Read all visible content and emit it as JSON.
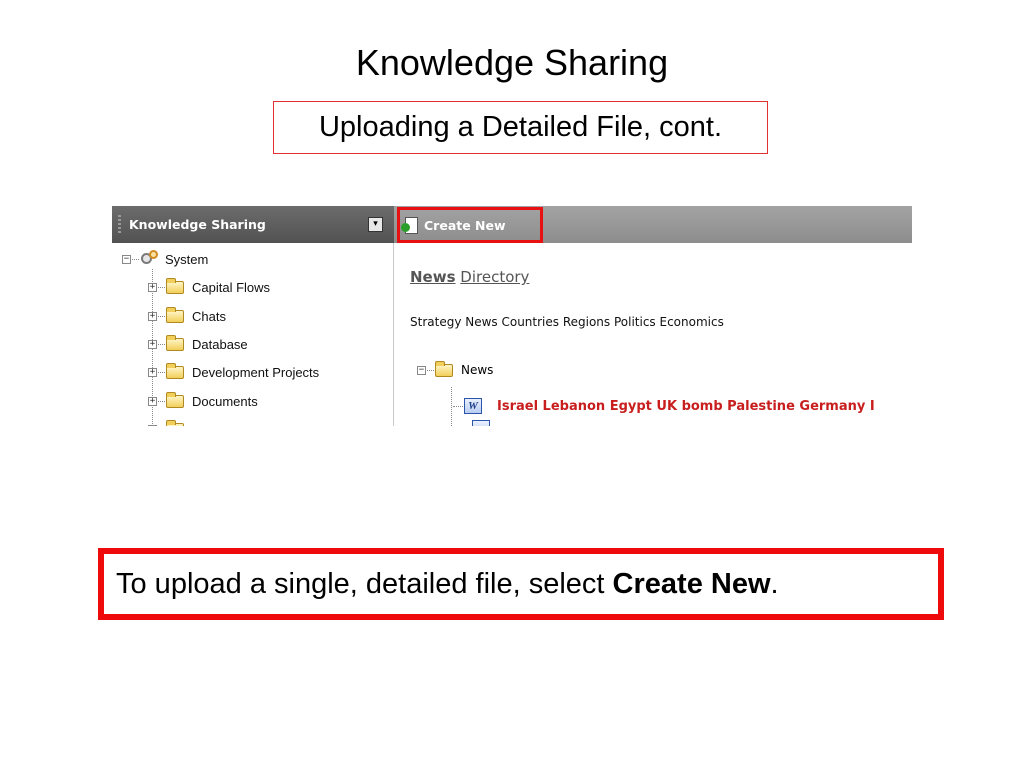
{
  "slide": {
    "title": "Knowledge Sharing",
    "subtitle": "Uploading a Detailed File, cont."
  },
  "app": {
    "left_panel": {
      "title": "Knowledge Sharing",
      "dropdown_glyph": "▾",
      "tree": {
        "root": {
          "expander": "−",
          "label": "System"
        },
        "items": [
          {
            "expander": "+",
            "label": "Capital Flows"
          },
          {
            "expander": "+",
            "label": "Chats"
          },
          {
            "expander": "+",
            "label": "Database"
          },
          {
            "expander": "+",
            "label": "Development Projects"
          },
          {
            "expander": "+",
            "label": "Documents"
          }
        ]
      }
    },
    "toolbar": {
      "create_new_label": "Create New",
      "highlight_color": "#e81010"
    },
    "main": {
      "breadcrumb_strong": "News",
      "breadcrumb_link": "Directory",
      "categories": "Strategy News Countries Regions Politics Economics",
      "news_folder": {
        "expander": "−",
        "label": "News"
      },
      "document": {
        "icon_letter": "W",
        "title": "Israel Lebanon Egypt UK bomb Palestine Germany I"
      }
    }
  },
  "instruction": {
    "prefix": "To upload a single, detailed file, select ",
    "bold": "Create New",
    "suffix": "."
  },
  "colors": {
    "callout_border": "#ee0a0a",
    "document_title": "#c81e1e"
  }
}
